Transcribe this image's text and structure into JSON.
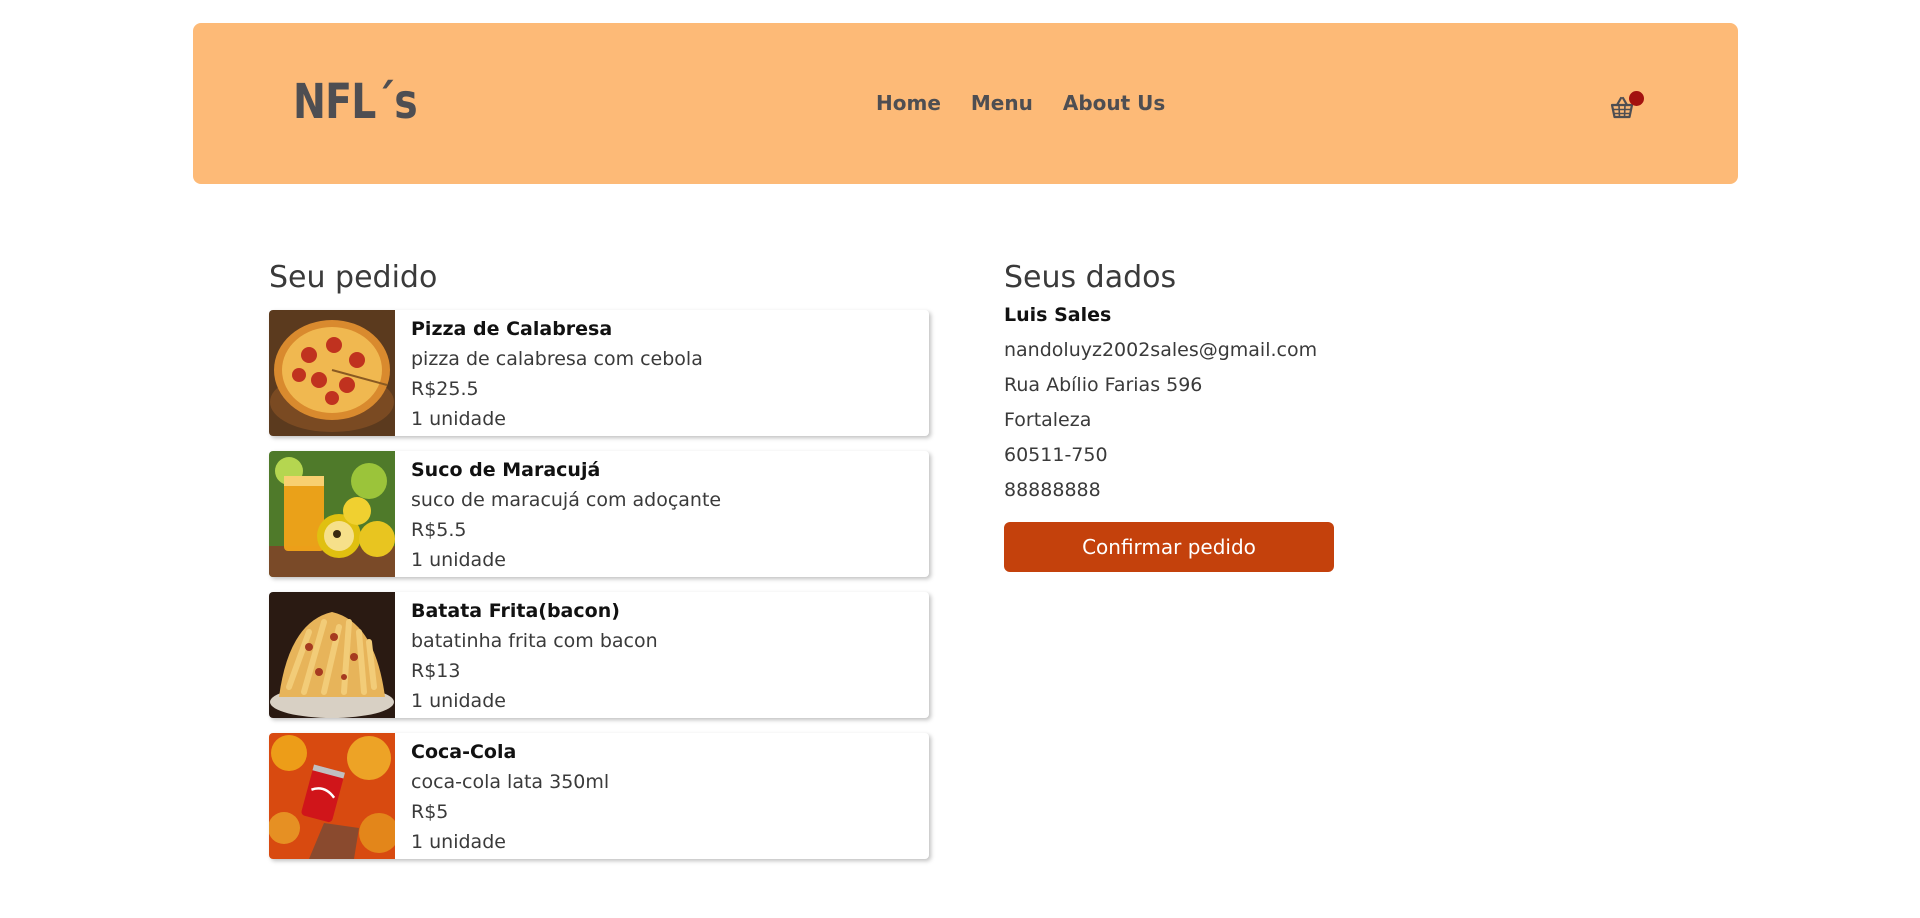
{
  "header": {
    "logo": "NFL´s",
    "nav": [
      {
        "label": "Home"
      },
      {
        "label": "Menu"
      },
      {
        "label": "About Us"
      }
    ],
    "cart_icon": "basket-icon",
    "cart_badge_color": "#a3120f",
    "background_color": "#fdba77"
  },
  "order": {
    "title": "Seu pedido",
    "items": [
      {
        "name": "Pizza de Calabresa",
        "description": "pizza de calabresa com cebola",
        "price": "R$25.5",
        "quantity": "1 unidade",
        "image": "pizza-image"
      },
      {
        "name": "Suco de Maracujá",
        "description": "suco de maracujá com adoçante",
        "price": "R$5.5",
        "quantity": "1 unidade",
        "image": "passion-fruit-juice-image"
      },
      {
        "name": "Batata Frita(bacon)",
        "description": "batatinha frita com bacon",
        "price": "R$13",
        "quantity": "1 unidade",
        "image": "fries-bacon-image"
      },
      {
        "name": "Coca-Cola",
        "description": "coca-cola lata 350ml",
        "price": "R$5",
        "quantity": "1 unidade",
        "image": "coca-cola-can-image"
      }
    ]
  },
  "customer": {
    "title": "Seus dados",
    "name": "Luis Sales",
    "email": "nandoluyz2002sales@gmail.com",
    "address": "Rua Abílio Farias 596",
    "city": "Fortaleza",
    "zip": "60511-750",
    "phone": "88888888",
    "confirm_label": "Confirmar pedido",
    "confirm_color": "#c4410c"
  }
}
